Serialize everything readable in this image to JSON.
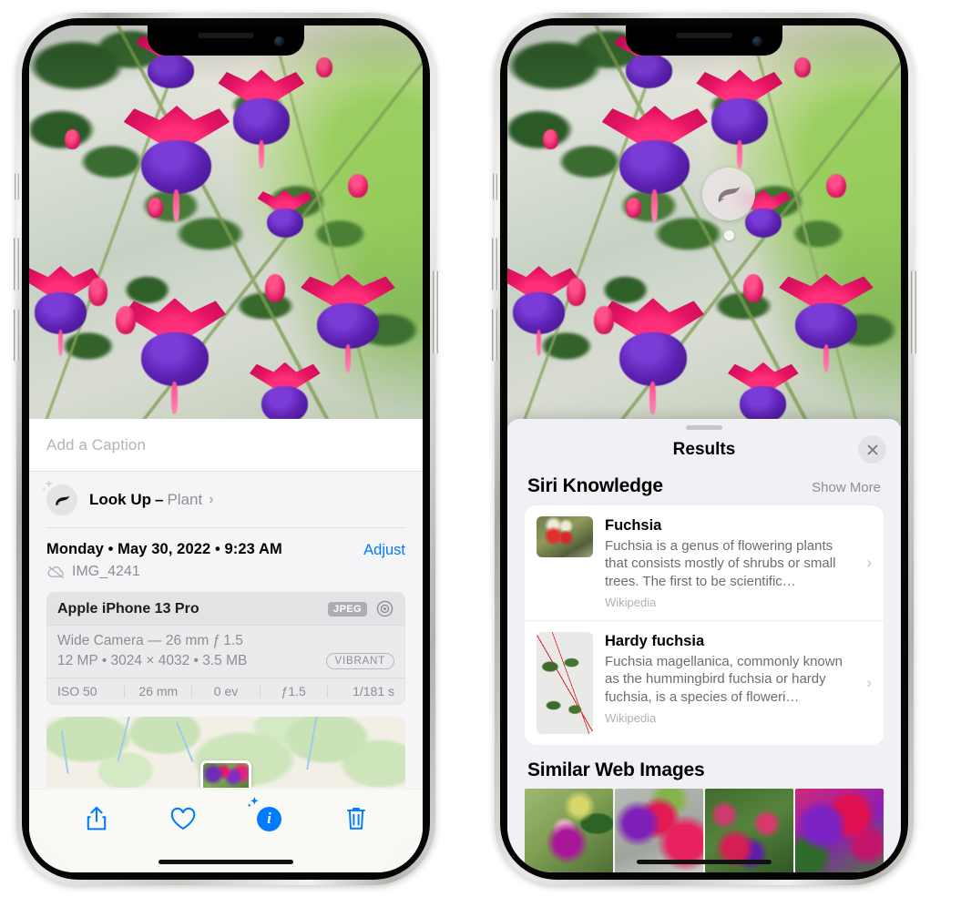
{
  "left_phone": {
    "caption": {
      "placeholder": "Add a Caption",
      "value": ""
    },
    "lookup": {
      "icon": "leaf-icon",
      "sparkle_icon": "sparkles-icon",
      "label": "Look Up",
      "dash": "–",
      "subject": "Plant",
      "chevron": "›"
    },
    "date_row": {
      "date": "Monday • May 30, 2022 • 9:23 AM",
      "adjust_label": "Adjust",
      "cloud_icon": "cloud-slash-icon",
      "filename": "IMG_4241"
    },
    "camera_card": {
      "device": "Apple iPhone 13 Pro",
      "format_tag": "JPEG",
      "aperture_icon": "aperture-icon",
      "lens": "Wide Camera — 26 mm ƒ 1.5",
      "specs": "12 MP • 3024 × 4032 • 3.5 MB",
      "style_tag": "VIBRANT",
      "exif": [
        "ISO 50",
        "26 mm",
        "0 ev",
        "ƒ1.5",
        "1/181 s"
      ]
    },
    "toolbar": [
      {
        "name": "share-button",
        "icon": "share-icon"
      },
      {
        "name": "favorite-button",
        "icon": "heart-icon"
      },
      {
        "name": "info-button",
        "icon": "info-sparkle-icon",
        "glyph": "i"
      },
      {
        "name": "delete-button",
        "icon": "trash-icon"
      }
    ]
  },
  "right_phone": {
    "badge": {
      "icon": "leaf-icon",
      "name": "visual-look-up-badge"
    },
    "sheet": {
      "title": "Results",
      "close_icon": "close-icon",
      "grabber": "drag-handle"
    },
    "siri_knowledge": {
      "heading": "Siri Knowledge",
      "show_more": "Show More",
      "items": [
        {
          "title": "Fuchsia",
          "description": "Fuchsia is a genus of flowering plants that consists mostly of shrubs or small trees. The first to be scientific…",
          "source": "Wikipedia",
          "chevron": "›"
        },
        {
          "title": "Hardy fuchsia",
          "description": "Fuchsia magellanica, commonly known as the hummingbird fuchsia or hardy fuchsia, is a species of floweri…",
          "source": "Wikipedia",
          "chevron": "›"
        }
      ]
    },
    "similar_web_images": {
      "heading": "Similar Web Images",
      "thumbnails": [
        "fuchsia-web-image-1",
        "fuchsia-web-image-2",
        "fuchsia-web-image-3",
        "fuchsia-web-image-4"
      ]
    }
  },
  "colors": {
    "accent_blue": "#007aff",
    "sheet_gray": "#f1f1f5",
    "info_gray": "#f5f5f7",
    "secondary_text": "#8e8e93"
  }
}
